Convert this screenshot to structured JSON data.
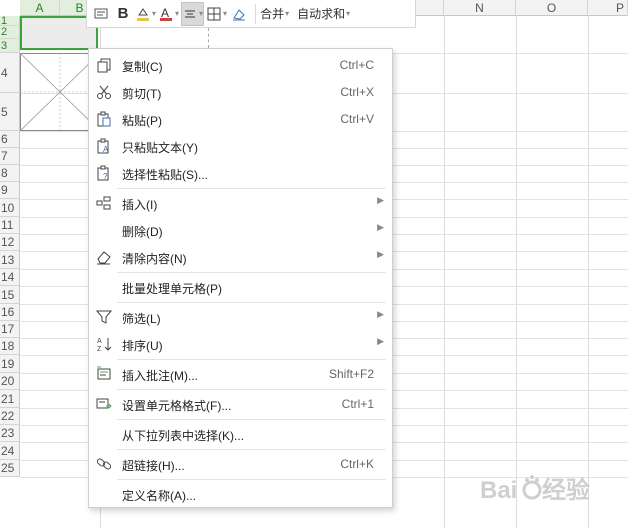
{
  "toolbar": {
    "merge_label": "合并",
    "autosum_label": "自动求和"
  },
  "columns": {
    "a": "A",
    "b": "B",
    "n": "N",
    "o": "O",
    "p": "P"
  },
  "rows": [
    "1",
    "2",
    "3",
    "4",
    "5",
    "6",
    "7",
    "8",
    "9",
    "10",
    "11",
    "12",
    "13",
    "14",
    "15",
    "16",
    "17",
    "18",
    "19",
    "20",
    "21",
    "22",
    "23",
    "24",
    "25"
  ],
  "menu": {
    "copy": {
      "label": "复制(C)",
      "shortcut": "Ctrl+C"
    },
    "cut": {
      "label": "剪切(T)",
      "shortcut": "Ctrl+X"
    },
    "paste": {
      "label": "粘贴(P)",
      "shortcut": "Ctrl+V"
    },
    "paste_text": {
      "label": "只粘贴文本(Y)"
    },
    "paste_special": {
      "label": "选择性粘贴(S)..."
    },
    "insert": {
      "label": "插入(I)"
    },
    "delete": {
      "label": "删除(D)"
    },
    "clear": {
      "label": "清除内容(N)"
    },
    "batch": {
      "label": "批量处理单元格(P)"
    },
    "filter": {
      "label": "筛选(L)"
    },
    "sort": {
      "label": "排序(U)"
    },
    "comment": {
      "label": "插入批注(M)...",
      "shortcut": "Shift+F2"
    },
    "format": {
      "label": "设置单元格格式(F)...",
      "shortcut": "Ctrl+1"
    },
    "dropdown": {
      "label": "从下拉列表中选择(K)..."
    },
    "hyperlink": {
      "label": "超链接(H)...",
      "shortcut": "Ctrl+K"
    },
    "define_name": {
      "label": "定义名称(A)..."
    }
  },
  "watermark": {
    "text": "Baidu 经验"
  },
  "colors": {
    "selection": "#3aa33a",
    "font_color": "#e53935",
    "fill_color": "#f4c430"
  }
}
